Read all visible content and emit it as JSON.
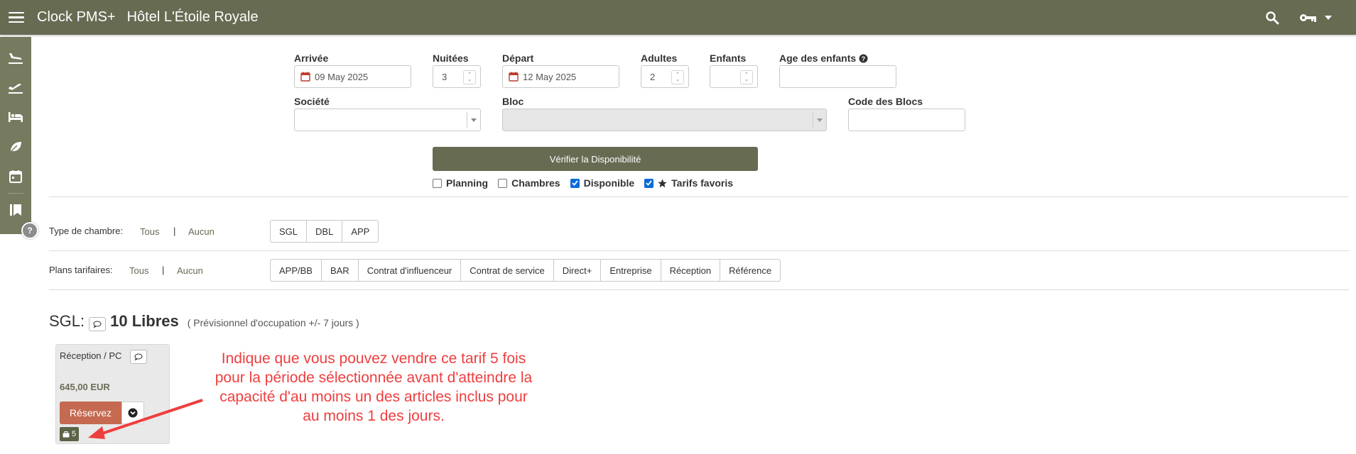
{
  "header": {
    "app_name": "Clock PMS+",
    "hotel_name": "Hôtel L'Étoile Royale",
    "bg_color": "#666b52"
  },
  "sidenav": {
    "items": [
      "plane-arrival-icon",
      "plane-departure-icon",
      "bed-icon",
      "leaf-icon",
      "calendar-icon",
      "bookmarks-icon"
    ],
    "help": "?"
  },
  "search": {
    "arrival_label": "Arrivée",
    "arrival_value": "09 May 2025",
    "nights_label": "Nuitées",
    "nights_value": "3",
    "departure_label": "Départ",
    "departure_value": "12 May 2025",
    "adults_label": "Adultes",
    "adults_value": "2",
    "children_label": "Enfants",
    "children_value": "",
    "children_age_label": "Age des enfants",
    "children_age_value": "",
    "company_label": "Société",
    "company_value": "",
    "block_label": "Bloc",
    "block_value": "",
    "block_code_label": "Code des Blocs",
    "block_code_value": "",
    "verify_label": "Vérifier la Disponibilité"
  },
  "options": [
    {
      "label": "Planning",
      "checked": false
    },
    {
      "label": "Chambres",
      "checked": false
    },
    {
      "label": "Disponible",
      "checked": true
    },
    {
      "label": "Tarifs favoris",
      "checked": true,
      "icon": "star-icon"
    }
  ],
  "room_filter": {
    "label": "Type de chambre:",
    "all": "Tous",
    "sep": "|",
    "none": "Aucun",
    "types": [
      "SGL",
      "DBL",
      "APP"
    ]
  },
  "rate_filter": {
    "label": "Plans tarifaires:",
    "all": "Tous",
    "sep": "|",
    "none": "Aucun",
    "plans": [
      "APP/BB",
      "BAR",
      "Contrat d'influenceur",
      "Contrat de service",
      "Direct+",
      "Entreprise",
      "Réception",
      "Référence"
    ]
  },
  "room_section": {
    "room_type": "SGL:",
    "free": "10 Libres",
    "forecast": "( Prévisionnel d'occupation +/- 7 jours )"
  },
  "rate_card": {
    "name": "Réception / PC",
    "price": "645,00 EUR",
    "reserve_label": "Réservez",
    "availability": "5"
  },
  "annotation": {
    "text": "Indique que vous pouvez vendre ce tarif 5 fois pour la période sélectionnée avant d'atteindre la capacité d'au moins un des articles inclus pour au moins 1 des jours.",
    "color": "#ef3e3e"
  }
}
